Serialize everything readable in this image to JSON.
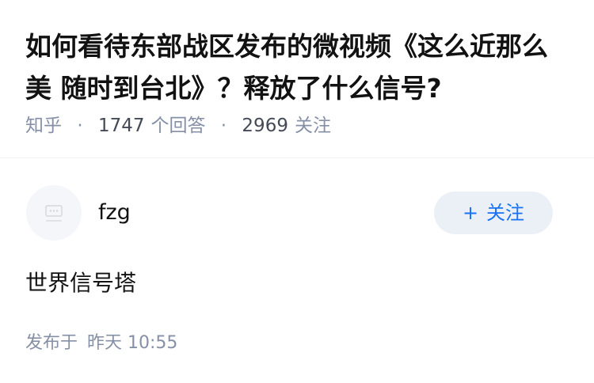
{
  "question": {
    "title": "如何看待东部战区发布的微视频《这么近那么美 随时到台北》？释放了什么信号?",
    "site": "知乎",
    "answer_count": "1747",
    "answer_label": "个回答",
    "follower_count": "2969",
    "follower_label": "关注"
  },
  "answer": {
    "author": {
      "name": "fzg",
      "avatar_icon": "default-avatar-icon"
    },
    "follow_button": {
      "icon": "plus-icon",
      "label": "关注"
    },
    "content": "世界信号塔",
    "published_label": "发布于",
    "published_time": "昨天 10:55"
  },
  "colors": {
    "primary_text": "#121212",
    "secondary_text": "#8590a6",
    "accent_blue": "#1772f6",
    "follow_bg": "#ebf0f7",
    "divider": "#f0f2f5"
  }
}
